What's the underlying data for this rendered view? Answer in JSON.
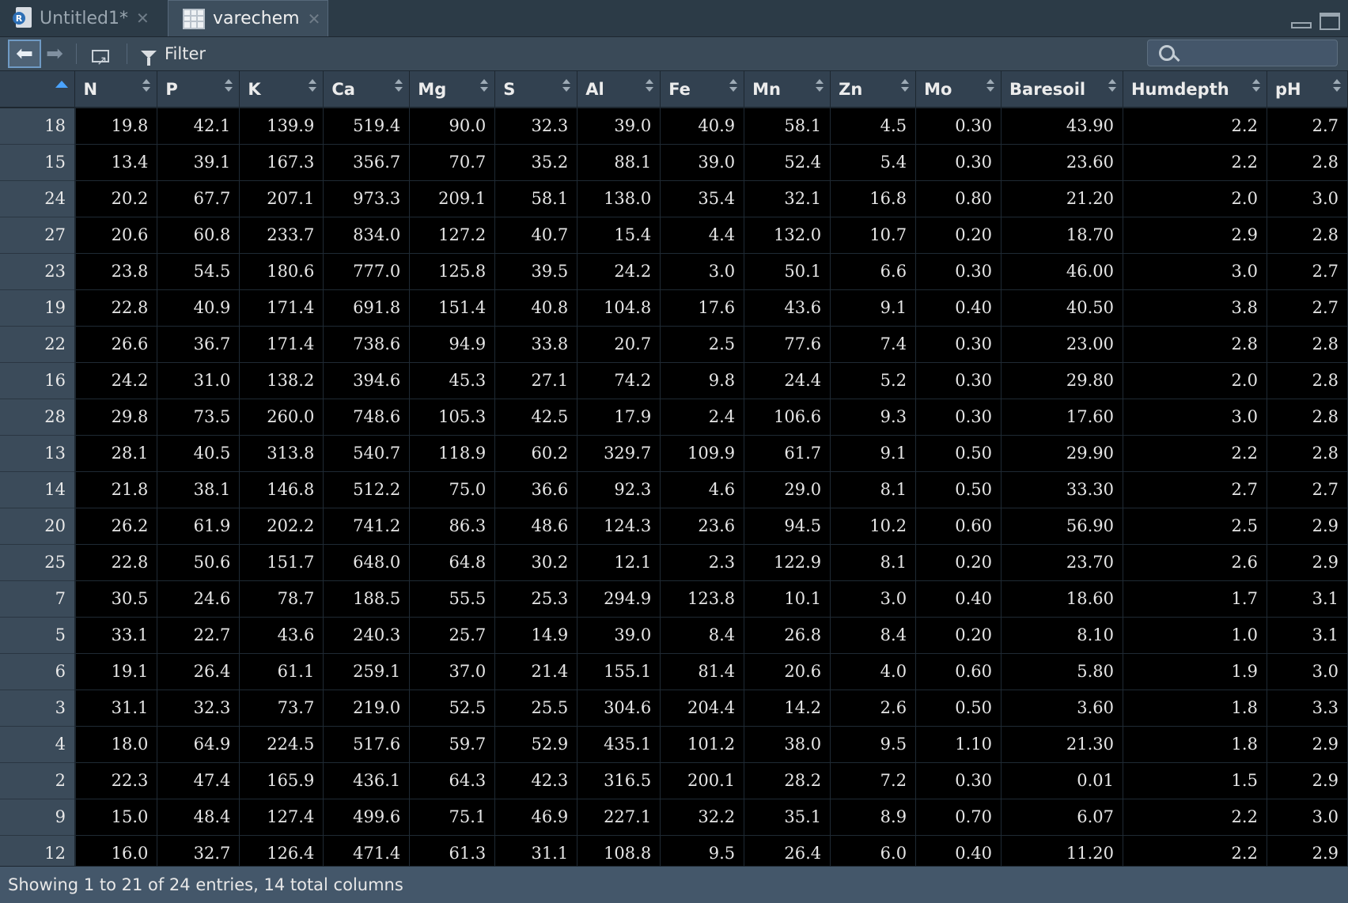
{
  "tabs": [
    {
      "label": "Untitled1*",
      "icon": "r-script-file-icon",
      "active": false
    },
    {
      "label": "varechem",
      "icon": "data-grid-icon",
      "active": true
    }
  ],
  "toolbar": {
    "back_icon": "arrow-left-icon",
    "forward_icon": "arrow-right-icon",
    "popout_icon": "popout-window-icon",
    "filter_label": "Filter",
    "search_placeholder": ""
  },
  "table": {
    "columns": [
      "N",
      "P",
      "K",
      "Ca",
      "Mg",
      "S",
      "Al",
      "Fe",
      "Mn",
      "Zn",
      "Mo",
      "Baresoil",
      "Humdepth",
      "pH"
    ],
    "rows": [
      {
        "id": "18",
        "values": [
          "19.8",
          "42.1",
          "139.9",
          "519.4",
          "90.0",
          "32.3",
          "39.0",
          "40.9",
          "58.1",
          "4.5",
          "0.30",
          "43.90",
          "2.2",
          "2.7"
        ]
      },
      {
        "id": "15",
        "values": [
          "13.4",
          "39.1",
          "167.3",
          "356.7",
          "70.7",
          "35.2",
          "88.1",
          "39.0",
          "52.4",
          "5.4",
          "0.30",
          "23.60",
          "2.2",
          "2.8"
        ]
      },
      {
        "id": "24",
        "values": [
          "20.2",
          "67.7",
          "207.1",
          "973.3",
          "209.1",
          "58.1",
          "138.0",
          "35.4",
          "32.1",
          "16.8",
          "0.80",
          "21.20",
          "2.0",
          "3.0"
        ]
      },
      {
        "id": "27",
        "values": [
          "20.6",
          "60.8",
          "233.7",
          "834.0",
          "127.2",
          "40.7",
          "15.4",
          "4.4",
          "132.0",
          "10.7",
          "0.20",
          "18.70",
          "2.9",
          "2.8"
        ]
      },
      {
        "id": "23",
        "values": [
          "23.8",
          "54.5",
          "180.6",
          "777.0",
          "125.8",
          "39.5",
          "24.2",
          "3.0",
          "50.1",
          "6.6",
          "0.30",
          "46.00",
          "3.0",
          "2.7"
        ]
      },
      {
        "id": "19",
        "values": [
          "22.8",
          "40.9",
          "171.4",
          "691.8",
          "151.4",
          "40.8",
          "104.8",
          "17.6",
          "43.6",
          "9.1",
          "0.40",
          "40.50",
          "3.8",
          "2.7"
        ]
      },
      {
        "id": "22",
        "values": [
          "26.6",
          "36.7",
          "171.4",
          "738.6",
          "94.9",
          "33.8",
          "20.7",
          "2.5",
          "77.6",
          "7.4",
          "0.30",
          "23.00",
          "2.8",
          "2.8"
        ]
      },
      {
        "id": "16",
        "values": [
          "24.2",
          "31.0",
          "138.2",
          "394.6",
          "45.3",
          "27.1",
          "74.2",
          "9.8",
          "24.4",
          "5.2",
          "0.30",
          "29.80",
          "2.0",
          "2.8"
        ]
      },
      {
        "id": "28",
        "values": [
          "29.8",
          "73.5",
          "260.0",
          "748.6",
          "105.3",
          "42.5",
          "17.9",
          "2.4",
          "106.6",
          "9.3",
          "0.30",
          "17.60",
          "3.0",
          "2.8"
        ]
      },
      {
        "id": "13",
        "values": [
          "28.1",
          "40.5",
          "313.8",
          "540.7",
          "118.9",
          "60.2",
          "329.7",
          "109.9",
          "61.7",
          "9.1",
          "0.50",
          "29.90",
          "2.2",
          "2.8"
        ]
      },
      {
        "id": "14",
        "values": [
          "21.8",
          "38.1",
          "146.8",
          "512.2",
          "75.0",
          "36.6",
          "92.3",
          "4.6",
          "29.0",
          "8.1",
          "0.50",
          "33.30",
          "2.7",
          "2.7"
        ]
      },
      {
        "id": "20",
        "values": [
          "26.2",
          "61.9",
          "202.2",
          "741.2",
          "86.3",
          "48.6",
          "124.3",
          "23.6",
          "94.5",
          "10.2",
          "0.60",
          "56.90",
          "2.5",
          "2.9"
        ]
      },
      {
        "id": "25",
        "values": [
          "22.8",
          "50.6",
          "151.7",
          "648.0",
          "64.8",
          "30.2",
          "12.1",
          "2.3",
          "122.9",
          "8.1",
          "0.20",
          "23.70",
          "2.6",
          "2.9"
        ]
      },
      {
        "id": "7",
        "values": [
          "30.5",
          "24.6",
          "78.7",
          "188.5",
          "55.5",
          "25.3",
          "294.9",
          "123.8",
          "10.1",
          "3.0",
          "0.40",
          "18.60",
          "1.7",
          "3.1"
        ]
      },
      {
        "id": "5",
        "values": [
          "33.1",
          "22.7",
          "43.6",
          "240.3",
          "25.7",
          "14.9",
          "39.0",
          "8.4",
          "26.8",
          "8.4",
          "0.20",
          "8.10",
          "1.0",
          "3.1"
        ]
      },
      {
        "id": "6",
        "values": [
          "19.1",
          "26.4",
          "61.1",
          "259.1",
          "37.0",
          "21.4",
          "155.1",
          "81.4",
          "20.6",
          "4.0",
          "0.60",
          "5.80",
          "1.9",
          "3.0"
        ]
      },
      {
        "id": "3",
        "values": [
          "31.1",
          "32.3",
          "73.7",
          "219.0",
          "52.5",
          "25.5",
          "304.6",
          "204.4",
          "14.2",
          "2.6",
          "0.50",
          "3.60",
          "1.8",
          "3.3"
        ]
      },
      {
        "id": "4",
        "values": [
          "18.0",
          "64.9",
          "224.5",
          "517.6",
          "59.7",
          "52.9",
          "435.1",
          "101.2",
          "38.0",
          "9.5",
          "1.10",
          "21.30",
          "1.8",
          "2.9"
        ]
      },
      {
        "id": "2",
        "values": [
          "22.3",
          "47.4",
          "165.9",
          "436.1",
          "64.3",
          "42.3",
          "316.5",
          "200.1",
          "28.2",
          "7.2",
          "0.30",
          "0.01",
          "1.5",
          "2.9"
        ]
      },
      {
        "id": "9",
        "values": [
          "15.0",
          "48.4",
          "127.4",
          "499.6",
          "75.1",
          "46.9",
          "227.1",
          "32.2",
          "35.1",
          "8.9",
          "0.70",
          "6.07",
          "2.2",
          "3.0"
        ]
      },
      {
        "id": "12",
        "values": [
          "16.0",
          "32.7",
          "126.4",
          "471.4",
          "61.3",
          "31.1",
          "108.8",
          "9.5",
          "26.4",
          "6.0",
          "0.40",
          "11.20",
          "2.2",
          "2.9"
        ]
      }
    ]
  },
  "status": {
    "text": "Showing 1 to 21 of 24 entries, 14 total columns"
  }
}
